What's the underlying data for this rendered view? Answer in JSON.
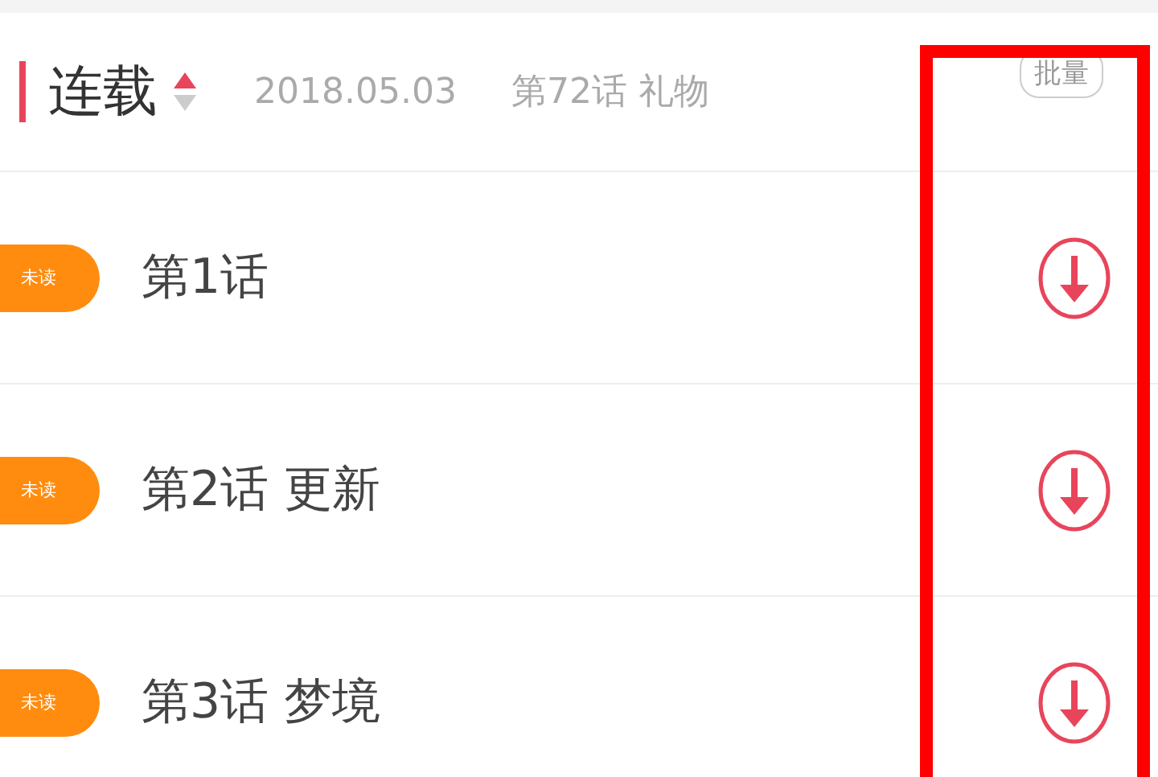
{
  "header": {
    "title": "连载",
    "sort_ascending": true,
    "date": "2018.05.03",
    "latest": "第72话 礼物",
    "batch_button": "批量"
  },
  "chapters": [
    {
      "badge": "未读",
      "title": "第1话"
    },
    {
      "badge": "未读",
      "title": "第2话 更新"
    },
    {
      "badge": "未读",
      "title": "第3话 梦境"
    }
  ],
  "highlight": {
    "color": "#ff0000"
  }
}
